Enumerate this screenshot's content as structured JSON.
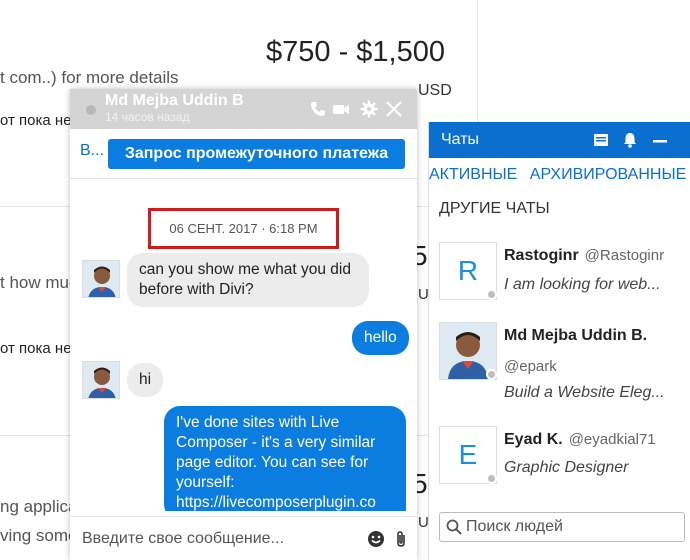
{
  "background": {
    "price": "$750 - $1,500",
    "currency": "USD",
    "line1": "t com..) for more details",
    "line2": "от пока не",
    "line3": "t how muc",
    "line4": "от пока не",
    "line5": "ng applica",
    "line6": "ving some",
    "price_fragment_1": "5",
    "currency_fragment_1": "U",
    "price_fragment_2": "5",
    "currency_fragment_2": "U"
  },
  "chats_panel": {
    "title": "Чаты",
    "tabs": [
      {
        "label": "АКТИВНЫЕ"
      },
      {
        "label": "АРХИВИРОВАННЫЕ"
      }
    ],
    "section_title": "ДРУГИЕ ЧАТЫ",
    "contacts": [
      {
        "initial": "R",
        "name": "Rastoginr",
        "handle": "@Rastoginr",
        "snippet": "I am looking for web..."
      },
      {
        "initial": "",
        "name": "Md Mejba Uddin B.",
        "handle": "@epark",
        "snippet": "Build a Website Eleg..."
      },
      {
        "initial": "E",
        "name": "Eyad K.",
        "handle": "@eyadkial71",
        "snippet": "Graphic Designer"
      }
    ],
    "search_placeholder": "Поиск людей"
  },
  "chat_window": {
    "contact_name": "Md Mejba Uddin B",
    "last_seen": "14 часов назад",
    "bar_short_label": "В...",
    "request_button": "Запрос промежуточного платежа",
    "date_stamp": "06 СЕНТ. 2017 · 6:18 PM",
    "messages": [
      {
        "from": "them",
        "text": "can you show me what you did before with Divi?"
      },
      {
        "from": "me",
        "text": "hello"
      },
      {
        "from": "them",
        "text": "hi"
      },
      {
        "from": "me",
        "text": "I've done sites with Live Composer - it's a very similar page editor. You can see for yourself: https://livecomposerplugin.co"
      }
    ],
    "composer_placeholder": "Введите свое сообщение..."
  },
  "colors": {
    "brand_blue": "#0b6fd0",
    "bubble_out": "#0b7ce0",
    "bubble_in": "#ececec",
    "highlight_red": "#d31a1a"
  },
  "icons": [
    "compose-icon",
    "bell-icon",
    "minimize-icon",
    "search-icon",
    "phone-icon",
    "video-icon",
    "gear-icon",
    "close-icon",
    "emoji-icon",
    "paperclip-icon"
  ]
}
